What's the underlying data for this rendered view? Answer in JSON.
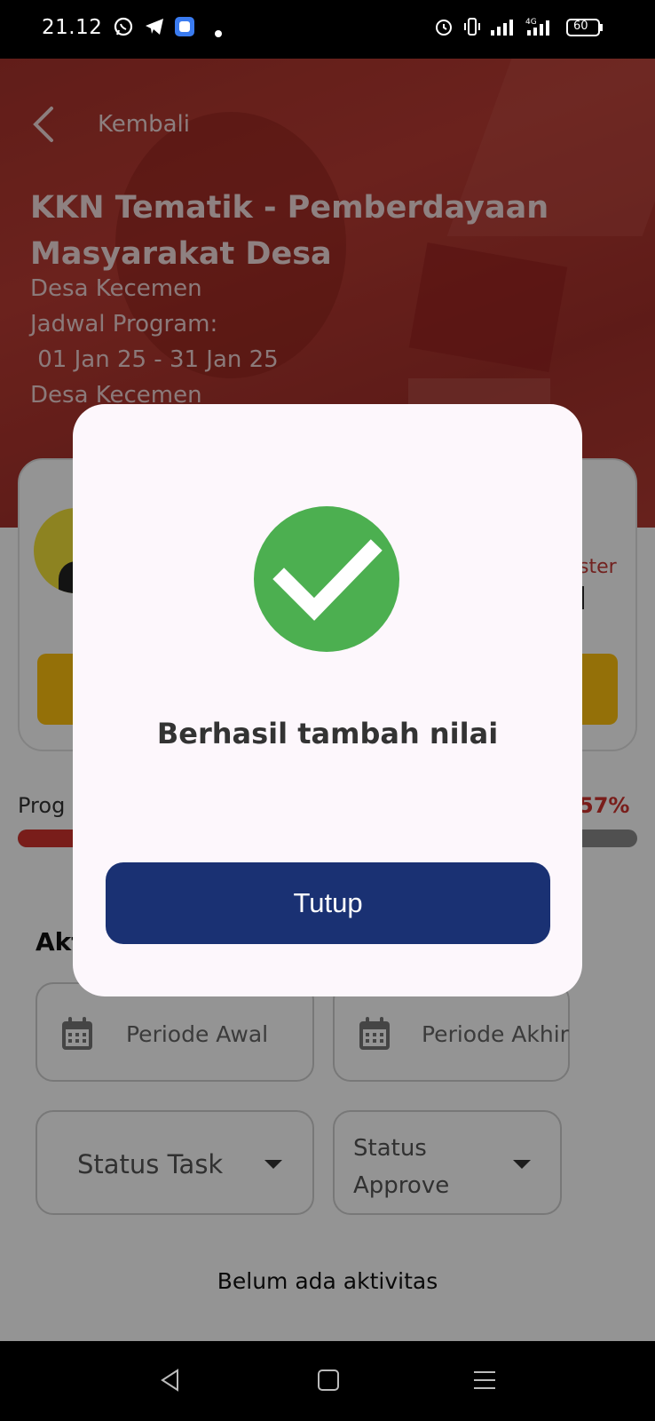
{
  "status_bar": {
    "time": "21.12",
    "battery": "60",
    "network": "4G"
  },
  "header": {
    "back_label": "Kembali",
    "title": "KKN Tematik - Pemberdayaan Masyarakat Desa",
    "location": "Desa Kecemen",
    "schedule_label": "Jadwal Program:",
    "schedule_dates": " 01 Jan 25 - 31 Jan 25",
    "location_2": "Desa Kecemen"
  },
  "card": {
    "role_partial": "ster"
  },
  "progress": {
    "label": "Prog",
    "percent_text": "57%",
    "value": 0.57
  },
  "activities": {
    "heading": "Akt",
    "period_start_placeholder": "Periode Awal",
    "period_end_placeholder": "Periode Akhir",
    "status_task": "Status Task",
    "status_approve": "Status Approve",
    "empty_text": "Belum ada aktivitas"
  },
  "dialog": {
    "message": "Berhasil tambah nilai",
    "button_label": "Tutup",
    "icon": "check-icon",
    "icon_color": "#4caf50"
  },
  "colors": {
    "primary_red": "#b93b33",
    "button_blue": "#1a3173",
    "accent_yellow": "#ffc20e"
  }
}
